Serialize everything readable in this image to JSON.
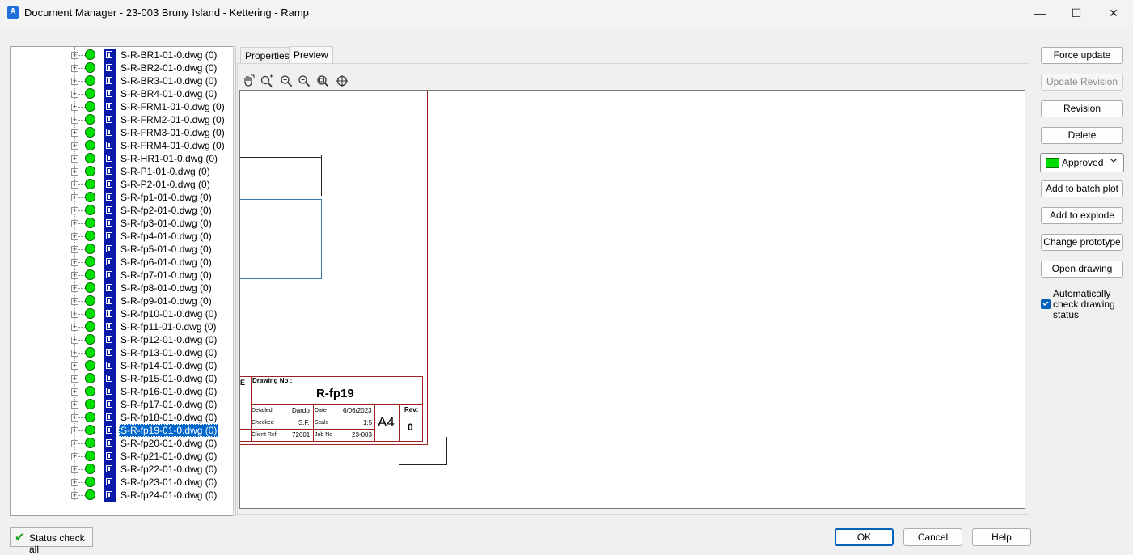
{
  "window": {
    "app_icon_letter": "A",
    "title": "Document Manager - 23-003 Bruny Island - Kettering - Ramp",
    "minimize": "—",
    "maximize": "☐",
    "close": "✕"
  },
  "tree": {
    "selected_index": 29,
    "items": [
      "S-R-BR1-01-0.dwg (0)",
      "S-R-BR2-01-0.dwg (0)",
      "S-R-BR3-01-0.dwg (0)",
      "S-R-BR4-01-0.dwg (0)",
      "S-R-FRM1-01-0.dwg (0)",
      "S-R-FRM2-01-0.dwg (0)",
      "S-R-FRM3-01-0.dwg (0)",
      "S-R-FRM4-01-0.dwg (0)",
      "S-R-HR1-01-0.dwg (0)",
      "S-R-P1-01-0.dwg (0)",
      "S-R-P2-01-0.dwg (0)",
      "S-R-fp1-01-0.dwg (0)",
      "S-R-fp2-01-0.dwg (0)",
      "S-R-fp3-01-0.dwg (0)",
      "S-R-fp4-01-0.dwg (0)",
      "S-R-fp5-01-0.dwg (0)",
      "S-R-fp6-01-0.dwg (0)",
      "S-R-fp7-01-0.dwg (0)",
      "S-R-fp8-01-0.dwg (0)",
      "S-R-fp9-01-0.dwg (0)",
      "S-R-fp10-01-0.dwg (0)",
      "S-R-fp11-01-0.dwg (0)",
      "S-R-fp12-01-0.dwg (0)",
      "S-R-fp13-01-0.dwg (0)",
      "S-R-fp14-01-0.dwg (0)",
      "S-R-fp15-01-0.dwg (0)",
      "S-R-fp16-01-0.dwg (0)",
      "S-R-fp17-01-0.dwg (0)",
      "S-R-fp18-01-0.dwg (0)",
      "S-R-fp19-01-0.dwg (0)",
      "S-R-fp20-01-0.dwg (0)",
      "S-R-fp21-01-0.dwg (0)",
      "S-R-fp22-01-0.dwg (0)",
      "S-R-fp23-01-0.dwg (0)",
      "S-R-fp24-01-0.dwg (0)"
    ],
    "status_color": "#00e000",
    "selection_color": "#0066cc"
  },
  "tabs": [
    {
      "label": "Properties"
    },
    {
      "label": "Preview"
    }
  ],
  "preview_tools": [
    "pan-icon",
    "zoom-realtime-icon",
    "zoom-in-icon",
    "zoom-out-icon",
    "zoom-extents-icon",
    "zoom-window-icon"
  ],
  "title_block": {
    "drawing_no_label": "Drawing No :",
    "drawing_no": "R-fp19",
    "detailed_label": "Detailed",
    "detailed_value": "Dardo",
    "date_label": "Date",
    "date_value": "6/06/2023",
    "checked_label": "Checked",
    "checked_value": "S.F.",
    "scale_label": "Scale",
    "scale_value": "1:5",
    "client_ref_label": "Client Ref",
    "client_ref_value": "72601",
    "job_no_label": "Job No",
    "job_no_value": "23-003",
    "sheet_size": "A4",
    "rev_label": "Rev:",
    "rev_value": "0",
    "edge_char": "E"
  },
  "actions": {
    "force_update": "Force update",
    "update_revision": "Update Revision",
    "revision": "Revision",
    "delete": "Delete",
    "status_value": "Approved",
    "status_color": "#00dd00",
    "add_batch_plot": "Add to batch plot",
    "add_explode": "Add to explode",
    "change_prototype": "Change prototype",
    "open_drawing": "Open drawing",
    "auto_check_label": "Automatically check drawing status",
    "auto_check_checked": true
  },
  "footer": {
    "status_check_all": "Status check all",
    "ok": "OK",
    "cancel": "Cancel",
    "help": "Help"
  }
}
